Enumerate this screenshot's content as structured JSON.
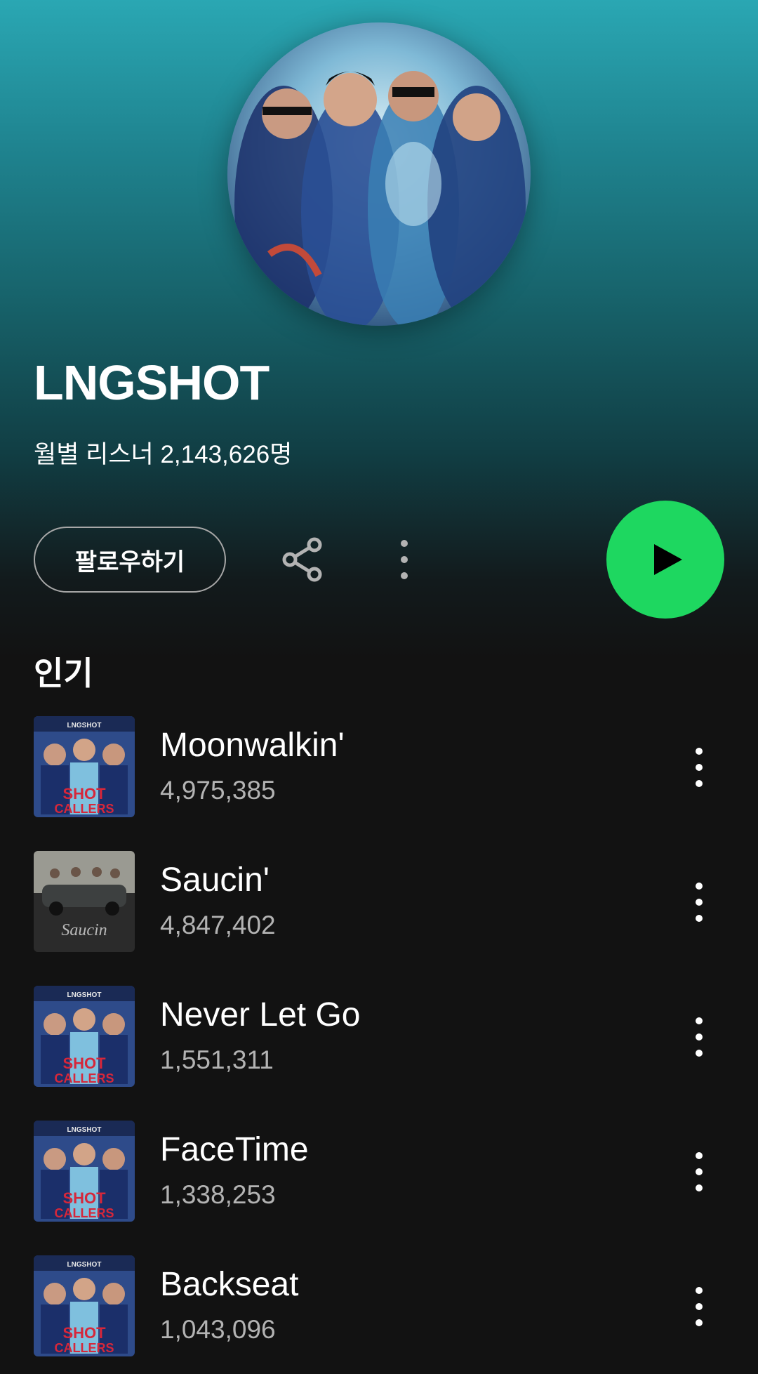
{
  "artist": {
    "name": "LNGSHOT",
    "monthly_listeners": "월별 리스너 2,143,626명"
  },
  "actions": {
    "follow_label": "팔로우하기",
    "share_icon": "share-icon",
    "more_icon": "more-vertical-icon",
    "play_icon": "play-icon",
    "accent_color": "#1ed760"
  },
  "popular": {
    "title": "인기",
    "tracks": [
      {
        "title": "Moonwalkin'",
        "plays": "4,975,385",
        "art": "shot-callers-cover"
      },
      {
        "title": "Saucin'",
        "plays": "4,847,402",
        "art": "saucin-cover"
      },
      {
        "title": "Never Let Go",
        "plays": "1,551,311",
        "art": "shot-callers-cover"
      },
      {
        "title": "FaceTime",
        "plays": "1,338,253",
        "art": "shot-callers-cover"
      },
      {
        "title": "Backseat",
        "plays": "1,043,096",
        "art": "shot-callers-cover"
      }
    ]
  }
}
